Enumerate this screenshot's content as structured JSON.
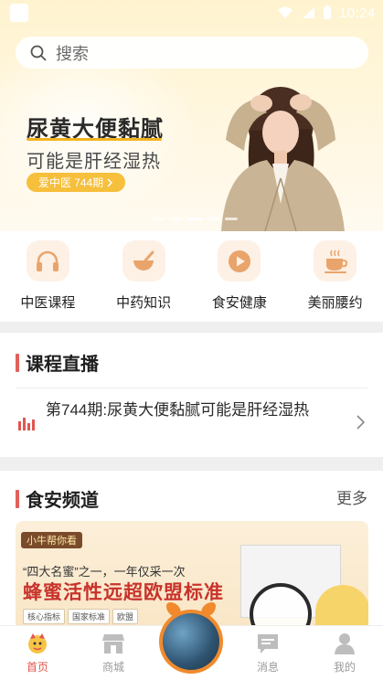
{
  "status_bar": {
    "time": "10:24"
  },
  "search": {
    "placeholder": "搜索"
  },
  "banner": {
    "title": "尿黄大便黏腻",
    "subtitle": "可能是肝经湿热",
    "badge": "爱中医 744期"
  },
  "categories": [
    {
      "label": "中医课程",
      "icon": "headphones-icon"
    },
    {
      "label": "中药知识",
      "icon": "mortar-pestle-icon"
    },
    {
      "label": "食安健康",
      "icon": "play-icon"
    },
    {
      "label": "美丽腰约",
      "icon": "coffee-cup-icon"
    }
  ],
  "live_section": {
    "title": "课程直播",
    "item_text": "第744期:尿黄大便黏腻可能是肝经湿热"
  },
  "food_section": {
    "title": "食安频道",
    "more": "更多",
    "card": {
      "brand": "小牛帮你看",
      "quote": "“四大名蜜”之一，一年仅采一次",
      "headline": "蜂蜜活性远超欧盟标准",
      "tags": [
        "核心指标",
        "国家标准",
        "欧盟"
      ]
    }
  },
  "tabbar": {
    "items": [
      {
        "label": "首页",
        "active": true
      },
      {
        "label": "商城",
        "active": false
      },
      {
        "label": "消息",
        "active": false
      },
      {
        "label": "我的",
        "active": false
      }
    ]
  },
  "colors": {
    "accent_red": "#e0564f",
    "banner_yellow": "#f6bf3c",
    "category_bg": "#fdf0e5",
    "icon_orange": "#e9a46b"
  }
}
